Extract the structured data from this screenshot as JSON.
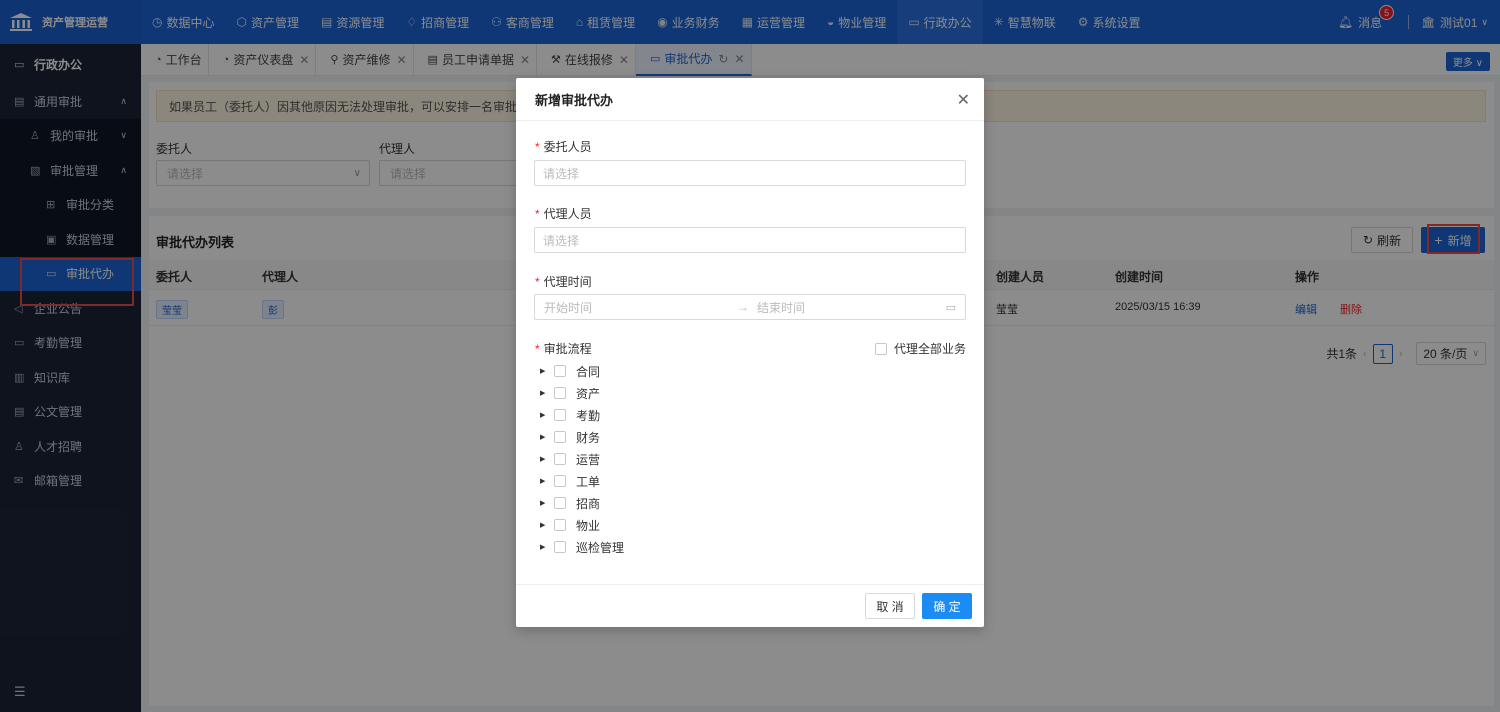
{
  "brand": {
    "name": "资产管理运营"
  },
  "topnav": [
    {
      "icon": "◷",
      "label": "数据中心"
    },
    {
      "icon": "⬡",
      "label": "资产管理"
    },
    {
      "icon": "▤",
      "label": "资源管理"
    },
    {
      "icon": "♢",
      "label": "招商管理"
    },
    {
      "icon": "⚇",
      "label": "客商管理"
    },
    {
      "icon": "⌂",
      "label": "租赁管理"
    },
    {
      "icon": "◉",
      "label": "业务财务"
    },
    {
      "icon": "▦",
      "label": "运营管理"
    },
    {
      "icon": "◒",
      "label": "物业管理"
    },
    {
      "icon": "▭",
      "label": "行政办公"
    },
    {
      "icon": "✳",
      "label": "智慧物联"
    },
    {
      "icon": "⚙",
      "label": "系统设置"
    }
  ],
  "topright": {
    "message_label": "消息",
    "message_count": "5",
    "user": "测试01"
  },
  "sidebar": {
    "section": "行政办公",
    "approval": "通用审批",
    "my_approval": "我的审批",
    "approval_mgmt": "审批管理",
    "category": "审批分类",
    "data_mgmt": "数据管理",
    "delegate": "审批代办",
    "announce": "企业公告",
    "attendance": "考勤管理",
    "knowledge": "知识库",
    "document": "公文管理",
    "recruit": "人才招聘",
    "mailbox": "邮箱管理"
  },
  "tabs": {
    "workbench": "工作台",
    "dashboard": "资产仪表盘",
    "maintenance": "资产维修",
    "employee": "员工申请单据",
    "repair": "在线报修",
    "delegate": "审批代办",
    "more": "更多"
  },
  "content": {
    "alert": "如果员工（委托人）因其他原因无法处理审批，可以安排一名审批代办人",
    "filter_client": "委托人",
    "filter_agent": "代理人",
    "select_placeholder": "请选择",
    "list_title": "审批代办列表",
    "refresh": "刷新",
    "add": "新增",
    "columns": {
      "client": "委托人",
      "agent": "代理人",
      "creator": "创建人员",
      "created": "创建时间",
      "ops": "操作"
    },
    "row": {
      "client": "莹莹",
      "agent": "彭",
      "creator": "莹莹",
      "created": "2025/03/15 16:39",
      "edit": "编辑",
      "delete": "删除"
    },
    "pager": {
      "total": "共1条",
      "page": "1",
      "size": "20 条/页"
    }
  },
  "modal": {
    "title": "新增审批代办",
    "client_label": "委托人员",
    "agent_label": "代理人员",
    "time_label": "代理时间",
    "flow_label": "审批流程",
    "placeholder": "请选择",
    "start": "开始时间",
    "end": "结束时间",
    "all_business": "代理全部业务",
    "tree": [
      "合同",
      "资产",
      "考勤",
      "财务",
      "运营",
      "工单",
      "招商",
      "物业",
      "巡检管理"
    ],
    "cancel": "取 消",
    "ok": "确 定"
  }
}
